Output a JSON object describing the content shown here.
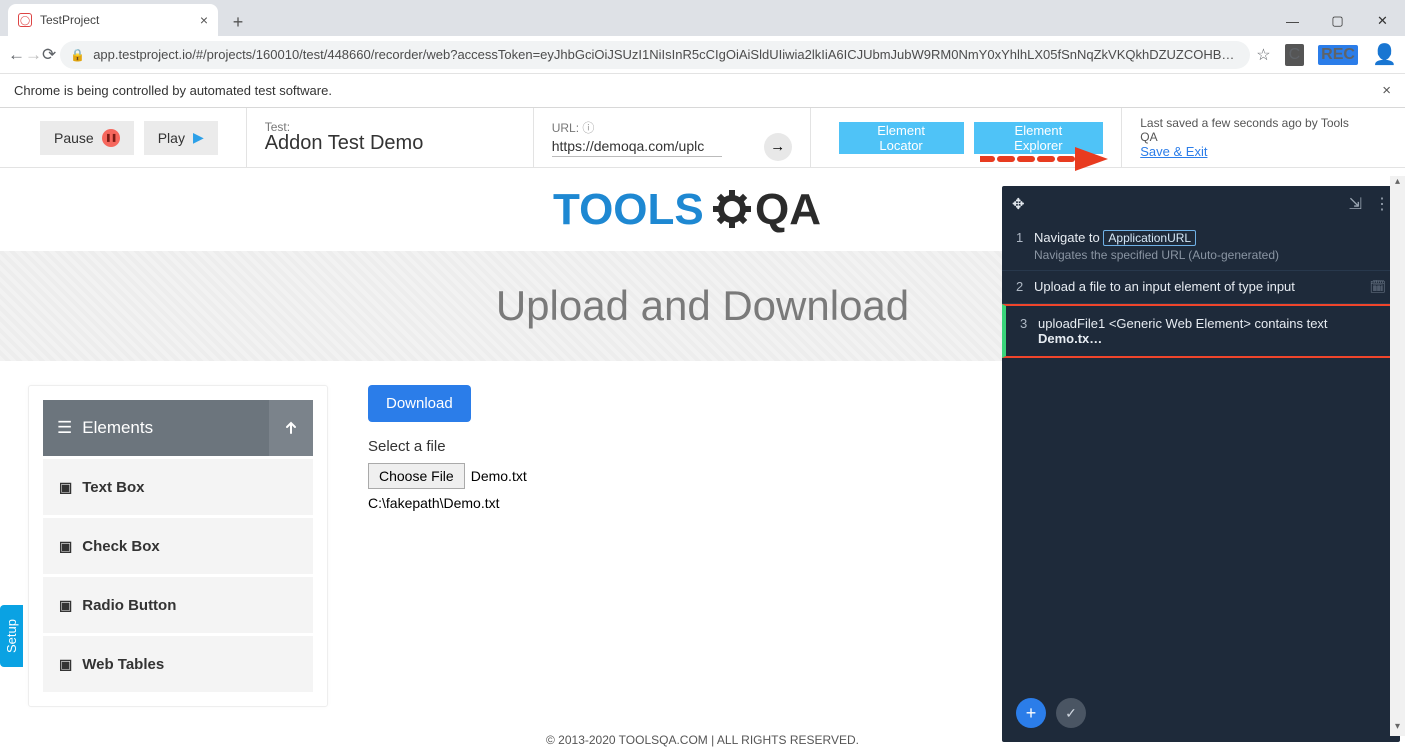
{
  "browser": {
    "tab_title": "TestProject",
    "url": "app.testproject.io/#/projects/160010/test/448660/recorder/web?accessToken=eyJhbGciOiJSUzI1NiIsInR5cCIgOiAiSldUIiwia2lkIiA6ICJUbmJubW9RM0NmY0xYhlhLX05fSnNqZkVKQkhDZUZCOHB…",
    "automation_notice": "Chrome is being controlled by automated test software.",
    "rec_badge": "REC"
  },
  "toolbar": {
    "pause": "Pause",
    "play": "Play",
    "test_label": "Test:",
    "test_name": "Addon Test Demo",
    "url_label": "URL:",
    "url_value": "https://demoqa.com/uplc",
    "element_locator": "Element Locator",
    "element_explorer": "Element Explorer",
    "last_saved": "Last saved a few seconds ago by Tools QA",
    "save_exit": "Save & Exit"
  },
  "page": {
    "heading": "Upload and Download",
    "download_btn": "Download",
    "select_file_label": "Select a file",
    "choose_file_btn": "Choose File",
    "chosen_file": "Demo.txt",
    "file_path": "C:\\fakepath\\Demo.txt",
    "footer": "© 2013-2020 TOOLSQA.COM | ALL RIGHTS RESERVED."
  },
  "sidebar": {
    "header": "Elements",
    "items": [
      "Text Box",
      "Check Box",
      "Radio Button",
      "Web Tables"
    ]
  },
  "steps": {
    "s1": {
      "num": "1",
      "prefix": "Navigate to",
      "param": "ApplicationURL",
      "sub": "Navigates the specified URL (Auto-generated)"
    },
    "s2": {
      "num": "2",
      "title": "Upload a file to an input element of type input"
    },
    "s3": {
      "num": "3",
      "prefix": "uploadFile1 <Generic Web Element> contains text ",
      "bold": "Demo.tx…"
    }
  },
  "setup_tab": "Setup",
  "logo": {
    "tools": "TOOLS",
    "qa": "QA"
  }
}
